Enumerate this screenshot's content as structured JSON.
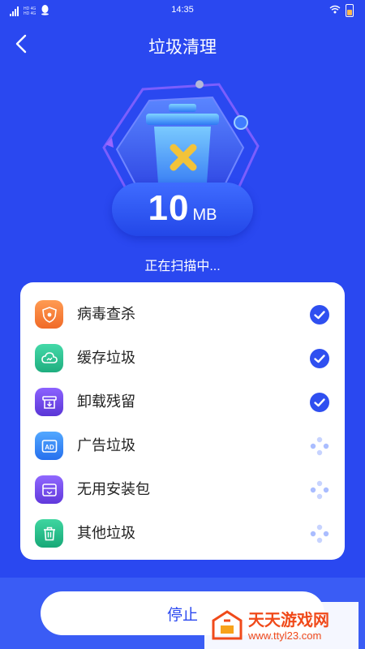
{
  "status_bar": {
    "time": "14:35",
    "network_label_1": "HD",
    "network_label_2": "4G",
    "network_label_3": "HD",
    "network_label_4": "4G"
  },
  "header": {
    "title": "垃圾清理"
  },
  "scan": {
    "size_value": "10",
    "size_unit": "MB",
    "status_text": "正在扫描中..."
  },
  "items": [
    {
      "label": "病毒查杀",
      "icon": "virus-shield-icon",
      "state": "done",
      "icon_color": "#f07a3a"
    },
    {
      "label": "缓存垃圾",
      "icon": "cloud-cache-icon",
      "state": "done",
      "icon_color": "#27c08e"
    },
    {
      "label": "卸载残留",
      "icon": "uninstall-box-icon",
      "state": "done",
      "icon_color": "#6a46e6"
    },
    {
      "label": "广告垃圾",
      "icon": "ad-icon",
      "state": "scanning",
      "icon_color": "#2f86f5"
    },
    {
      "label": "无用安装包",
      "icon": "package-icon",
      "state": "scanning",
      "icon_color": "#7a48e8"
    },
    {
      "label": "其他垃圾",
      "icon": "trash-icon",
      "state": "scanning",
      "icon_color": "#22b888"
    }
  ],
  "actions": {
    "stop_label": "停止"
  },
  "watermark": {
    "title": "天天游戏网",
    "url": "www.ttyl23.com"
  },
  "colors": {
    "background": "#2a48f0",
    "accent": "#2a48f0",
    "trash_mark": "#f2c33a"
  }
}
